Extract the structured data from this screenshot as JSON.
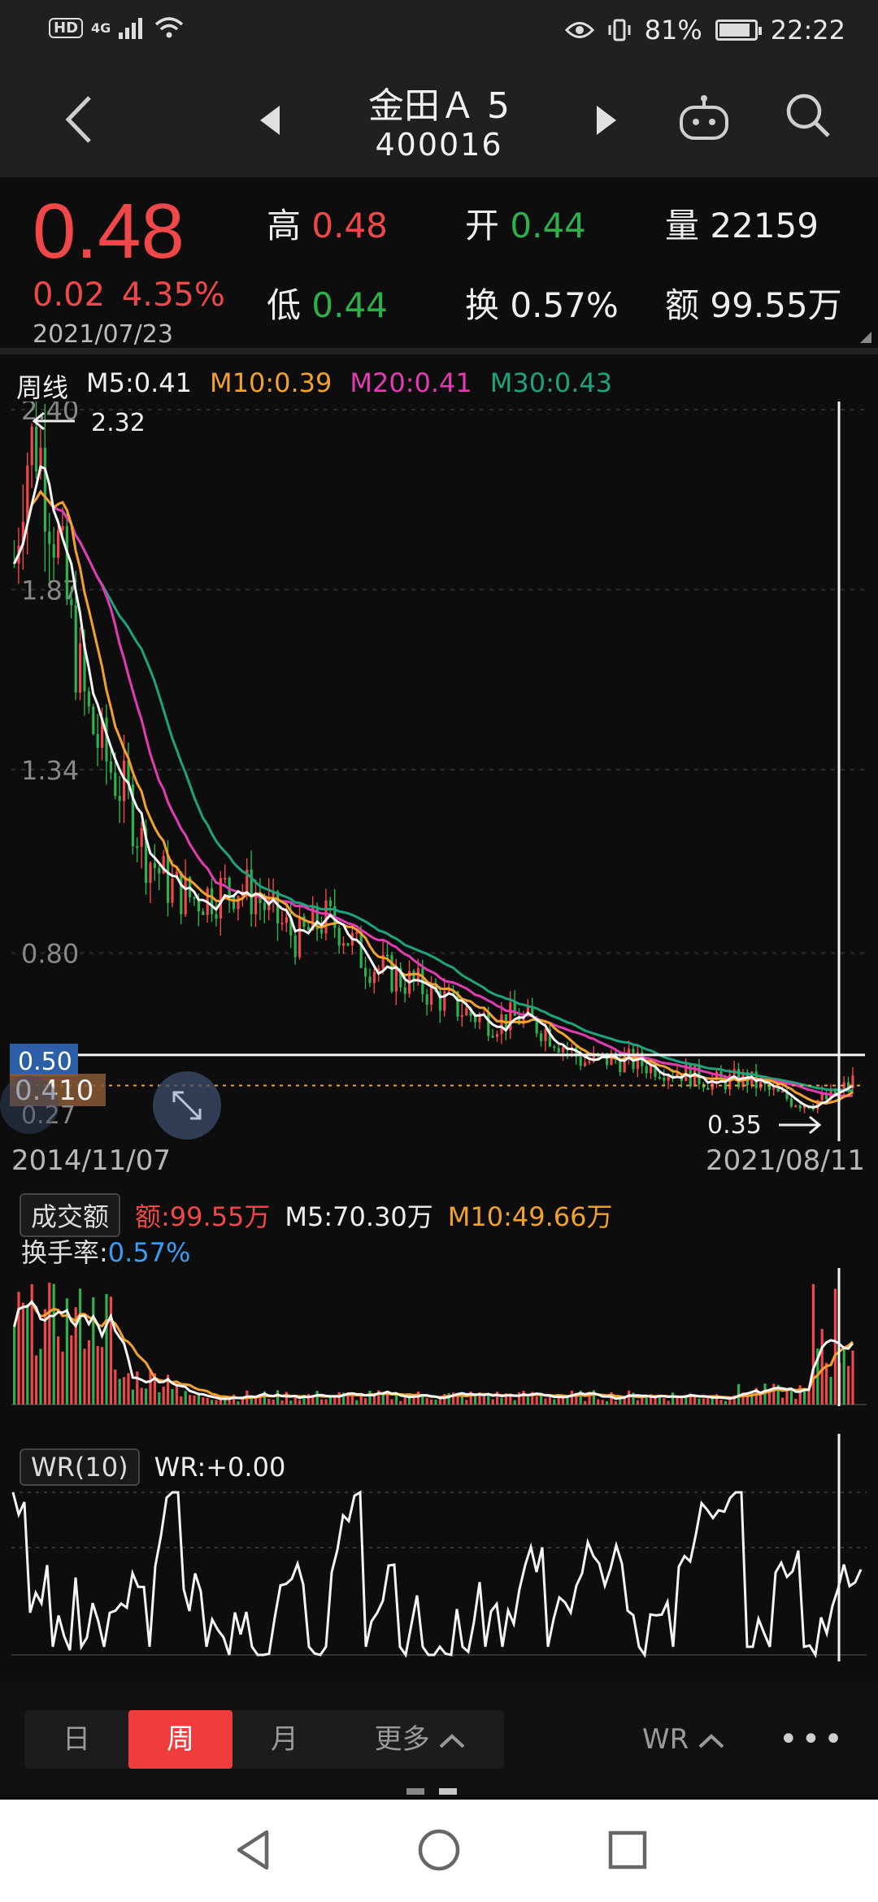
{
  "status_bar": {
    "network_badge": "HD",
    "signal": "4G",
    "battery": "81%",
    "battery_level": 0.81,
    "time": "22:22"
  },
  "header": {
    "stock_name": "金田Ａ 5",
    "stock_code": "400016"
  },
  "quote": {
    "last_price": "0.48",
    "change": "0.02",
    "change_pct": "4.35%",
    "date": "2021/07/23",
    "high_label": "高",
    "high": "0.48",
    "open_label": "开",
    "open": "0.44",
    "volume_label": "量",
    "volume": "22159",
    "low_label": "低",
    "low": "0.44",
    "turnover_label": "换",
    "turnover": "0.57%",
    "amount_label": "额",
    "amount": "99.55万"
  },
  "ma_legend": {
    "period": "周线",
    "m5": "M5:0.41",
    "m10": "M10:0.39",
    "m20": "M20:0.41",
    "m30": "M30:0.43"
  },
  "price_chart": {
    "y_labels": [
      "2.40",
      "1.87",
      "1.34",
      "0.80"
    ],
    "y_values": [
      2.4,
      1.87,
      1.34,
      0.8
    ],
    "ylim": [
      0.27,
      2.4
    ],
    "low_tick": "0.27",
    "max_marker": "2.32",
    "min_marker": "0.35",
    "crosshair_price": "0.50",
    "dashed_value": "0.410",
    "start_date": "2014/11/07",
    "end_date": "2021/08/11"
  },
  "volume_panel": {
    "label": "成交额",
    "amount": "额:99.55万",
    "m5": "M5:70.30万",
    "m10": "M10:49.66万",
    "turnover_label": "换手率:",
    "turnover_value": "0.57%"
  },
  "wr_panel": {
    "label": "WR(10)",
    "value": "WR:+0.00"
  },
  "period_tabs": {
    "items": [
      "日",
      "周",
      "月",
      "更多"
    ],
    "active": "周",
    "indicator_select": "WR",
    "more": "•••"
  },
  "colors": {
    "up": "#f04848",
    "down": "#2fb04a",
    "m5": "#f0f0f0",
    "m10": "#f2a12d",
    "m20": "#e33bb2",
    "m30": "#1ea37e",
    "active_tab": "#ef3d3d"
  }
}
